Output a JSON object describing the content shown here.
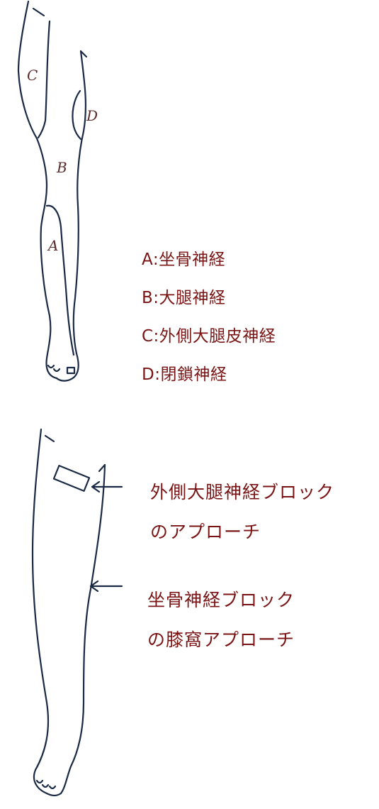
{
  "top_figure": {
    "zone_labels": [
      "C",
      "D",
      "B",
      "A"
    ],
    "legend": [
      "A:坐骨神経",
      "B:大腿神経",
      "C:外側大腿皮神経",
      "D:閉鎖神経"
    ]
  },
  "bottom_figure": {
    "callouts": [
      {
        "line1": "外側大腿神経ブロック",
        "line2": "のアプローチ"
      },
      {
        "line1": "坐骨神経ブロック",
        "line2": "の膝窩アプローチ"
      }
    ]
  },
  "colors": {
    "ink": "#1a2a44",
    "text": "#7a1414"
  }
}
